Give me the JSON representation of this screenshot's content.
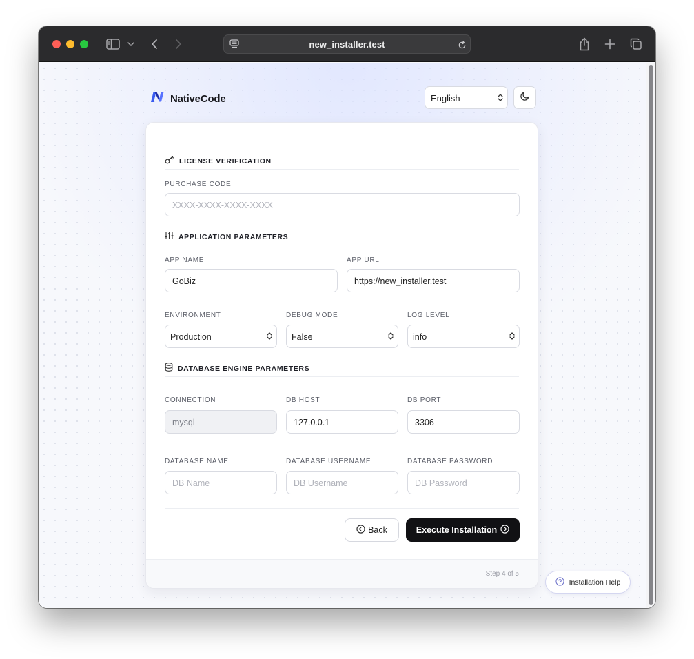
{
  "browser": {
    "url": "new_installer.test"
  },
  "header": {
    "brand_name": "NativeCode",
    "language_selected": "English"
  },
  "sections": {
    "license": {
      "title": "LICENSE VERIFICATION"
    },
    "application": {
      "title": "APPLICATION PARAMETERS"
    },
    "database": {
      "title": "DATABASE ENGINE PARAMETERS"
    }
  },
  "fields": {
    "purchase_code": {
      "label": "PURCHASE CODE",
      "placeholder": "XXXX-XXXX-XXXX-XXXX"
    },
    "app_name": {
      "label": "APP NAME",
      "value": "GoBiz"
    },
    "app_url": {
      "label": "APP URL",
      "value": "https://new_installer.test"
    },
    "environment": {
      "label": "ENVIRONMENT",
      "value": "Production"
    },
    "debug_mode": {
      "label": "DEBUG MODE",
      "value": "False"
    },
    "log_level": {
      "label": "LOG LEVEL",
      "value": "info"
    },
    "connection": {
      "label": "CONNECTION",
      "value": "mysql"
    },
    "db_host": {
      "label": "DB HOST",
      "value": "127.0.0.1"
    },
    "db_port": {
      "label": "DB PORT",
      "value": "3306"
    },
    "db_name": {
      "label": "DATABASE NAME",
      "placeholder": "DB Name"
    },
    "db_username": {
      "label": "DATABASE USERNAME",
      "placeholder": "DB Username"
    },
    "db_password": {
      "label": "DATABASE PASSWORD",
      "placeholder": "DB Password"
    }
  },
  "actions": {
    "back_label": "Back",
    "execute_label": "Execute Installation"
  },
  "footer": {
    "step_text": "Step 4 of 5"
  },
  "help": {
    "label": "Installation Help"
  },
  "colors": {
    "primary_button": "#111114",
    "brand_blue": "#2f4de0",
    "page_background": "#f7f8fc"
  }
}
